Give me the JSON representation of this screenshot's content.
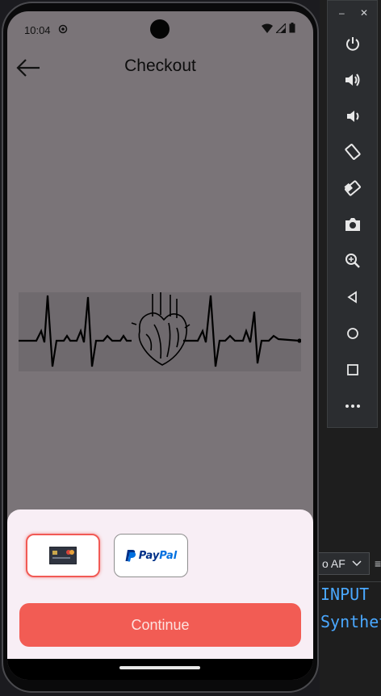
{
  "status_bar": {
    "time": "10:04"
  },
  "app_bar": {
    "title": "Checkout"
  },
  "payment": {
    "paypal_label_1": "Pay",
    "paypal_label_2": "Pal",
    "continue_label": "Continue"
  },
  "ide": {
    "dropdown_label": "o AF",
    "code_lines": [
      "INPUT",
      "Synthet"
    ]
  },
  "colors": {
    "accent": "#f25c54",
    "sheet_bg": "#f8eef5",
    "screen_bg": "#7a7478"
  }
}
